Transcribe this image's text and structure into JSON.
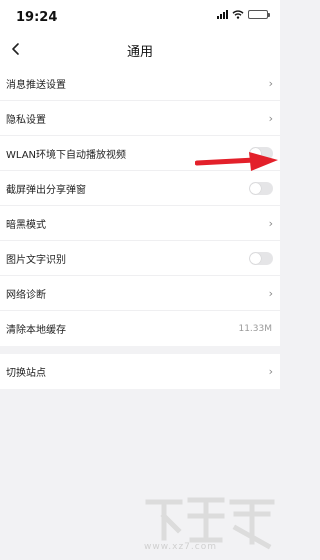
{
  "status_bar": {
    "time": "19:24"
  },
  "header": {
    "title": "通用"
  },
  "settings": [
    {
      "label": "消息推送设置",
      "type": "link"
    },
    {
      "label": "隐私设置",
      "type": "link"
    },
    {
      "label": "WLAN环境下自动播放视频",
      "type": "toggle",
      "on": false
    },
    {
      "label": "截屏弹出分享弹窗",
      "type": "toggle",
      "on": false
    },
    {
      "label": "暗黑模式",
      "type": "link"
    },
    {
      "label": "图片文字识别",
      "type": "toggle",
      "on": false
    },
    {
      "label": "网络诊断",
      "type": "link"
    },
    {
      "label": "清除本地缓存",
      "type": "value",
      "value": "11.33M"
    }
  ],
  "site": {
    "label": "切换站点",
    "type": "link"
  },
  "icons": {
    "chevron": "›",
    "back": "chevron-left-icon"
  },
  "colors": {
    "annotation_arrow": "#e3202a",
    "toggle_off": "#e5e5e7"
  },
  "watermark": {
    "text": "www.xz7.com"
  }
}
